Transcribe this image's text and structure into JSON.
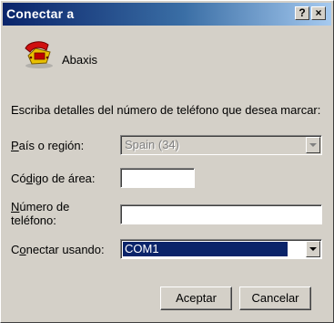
{
  "window": {
    "title": "Conectar a"
  },
  "titlebar": {
    "help_label": "?",
    "close_label": "×"
  },
  "connection": {
    "name": "Abaxis",
    "icon": "phone-icon"
  },
  "instruction": "Escriba detalles del número de teléfono que desea marcar:",
  "form": {
    "country_label_accel": "P",
    "country_label_rest": "aís o región:",
    "country_value": "Spain (34)",
    "area_label_pre": "Có",
    "area_label_accel": "d",
    "area_label_post": "igo de área:",
    "area_value": "",
    "phone_label_accel": "N",
    "phone_label_line1_rest": "úmero de",
    "phone_label_line2": "teléfono:",
    "phone_value": "",
    "connect_label_pre": "C",
    "connect_label_accel": "o",
    "connect_label_post": "nectar usando:",
    "connect_value": "COM1"
  },
  "buttons": {
    "ok": "Aceptar",
    "cancel": "Cancelar"
  }
}
